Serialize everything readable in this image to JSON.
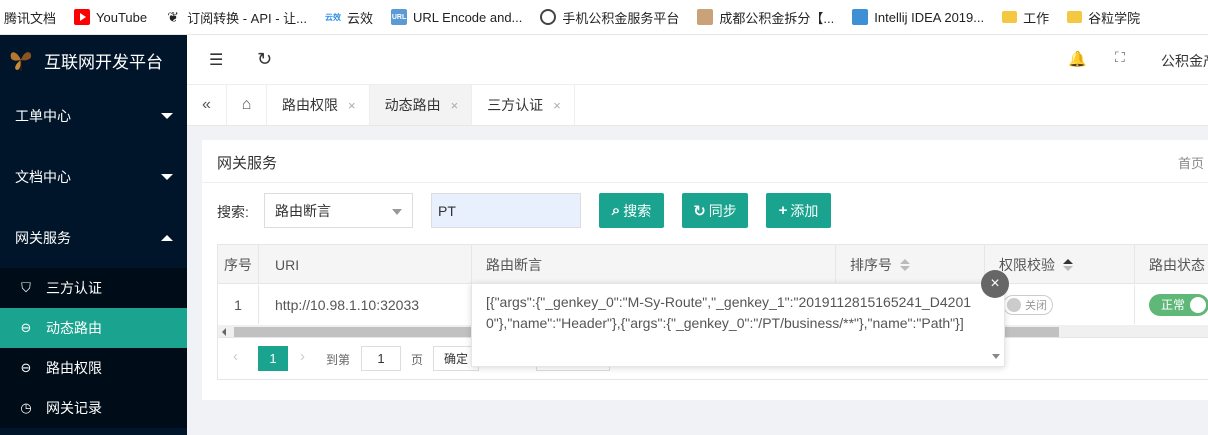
{
  "bookmarks": [
    {
      "label": "腾讯文档",
      "icon": "none"
    },
    {
      "label": "YouTube",
      "icon": "youtube-icon"
    },
    {
      "label": "订阅转换 - API - 让...",
      "icon": "leaf-icon"
    },
    {
      "label": "云效",
      "icon": "cloud-icon",
      "badge": "云效"
    },
    {
      "label": "URL Encode and...",
      "icon": "url-icon",
      "badge": "URL"
    },
    {
      "label": "手机公积金服务平台",
      "icon": "globe-icon"
    },
    {
      "label": "成都公积金拆分【...",
      "icon": "avatar-icon"
    },
    {
      "label": "Intellij IDEA 2019...",
      "icon": "idea-icon"
    },
    {
      "label": "工作",
      "icon": "folder-icon"
    },
    {
      "label": "谷粒学院",
      "icon": "folder-icon"
    }
  ],
  "sidebar": {
    "logo_text": "互联网开发平台",
    "groups": [
      {
        "label": "工单中心",
        "expanded": false
      },
      {
        "label": "文档中心",
        "expanded": false
      },
      {
        "label": "网关服务",
        "expanded": true
      }
    ],
    "sub_items": [
      {
        "label": "三方认证",
        "icon": "shield-icon",
        "glyph": "⛉"
      },
      {
        "label": "动态路由",
        "icon": "route-icon",
        "glyph": "⊖",
        "active": true
      },
      {
        "label": "路由权限",
        "icon": "permission-icon",
        "glyph": "⊖"
      },
      {
        "label": "网关记录",
        "icon": "clock-icon",
        "glyph": "◷"
      }
    ]
  },
  "header": {
    "fold_glyph": "☰",
    "refresh_glyph": "↻",
    "bell_glyph": "🔔",
    "fullscreen_glyph": "⛶",
    "user_name": "公积金产"
  },
  "tabs": {
    "collapse_glyph": "«",
    "home_glyph": "⌂",
    "items": [
      {
        "label": "路由权限",
        "close": "×",
        "active": false
      },
      {
        "label": "动态路由",
        "close": "×",
        "active": true
      },
      {
        "label": "三方认证",
        "close": "×",
        "active": false
      }
    ]
  },
  "page": {
    "title": "网关服务",
    "breadcrumb": "首页",
    "search_label": "搜索:",
    "search_type": "路由断言",
    "search_value": "PT",
    "buttons": {
      "search": {
        "label": "搜索",
        "glyph": "⌕"
      },
      "sync": {
        "label": "同步",
        "glyph": "↻"
      },
      "add": {
        "label": "添加",
        "glyph": "+"
      }
    }
  },
  "table": {
    "columns": [
      "序号",
      "URI",
      "路由断言",
      "排序号",
      "权限校验",
      "路由状态"
    ],
    "rows": [
      {
        "index": "1",
        "uri": "http://10.98.1.10:32033",
        "predicate": "",
        "order": "",
        "auth": "关闭",
        "status": "正常"
      }
    ]
  },
  "popup": {
    "text": "[{\"args\":{\"_genkey_0\":\"M-Sy-Route\",\"_genkey_1\":\"2019112815165241_D42010\"},\"name\":\"Header\"},{\"args\":{\"_genkey_0\":\"/PT/business/**\"},\"name\":\"Path\"}]",
    "close_glyph": "×"
  },
  "pagination": {
    "prev_glyph": "‹",
    "current_page": "1",
    "next_glyph": "›",
    "goto_label": "到第",
    "goto_value": "1",
    "page_label": "页",
    "confirm_label": "确定"
  },
  "colors": {
    "accent": "#1aa38f",
    "sidebar_bg": "#001529",
    "toggle_on": "#5fb878"
  }
}
